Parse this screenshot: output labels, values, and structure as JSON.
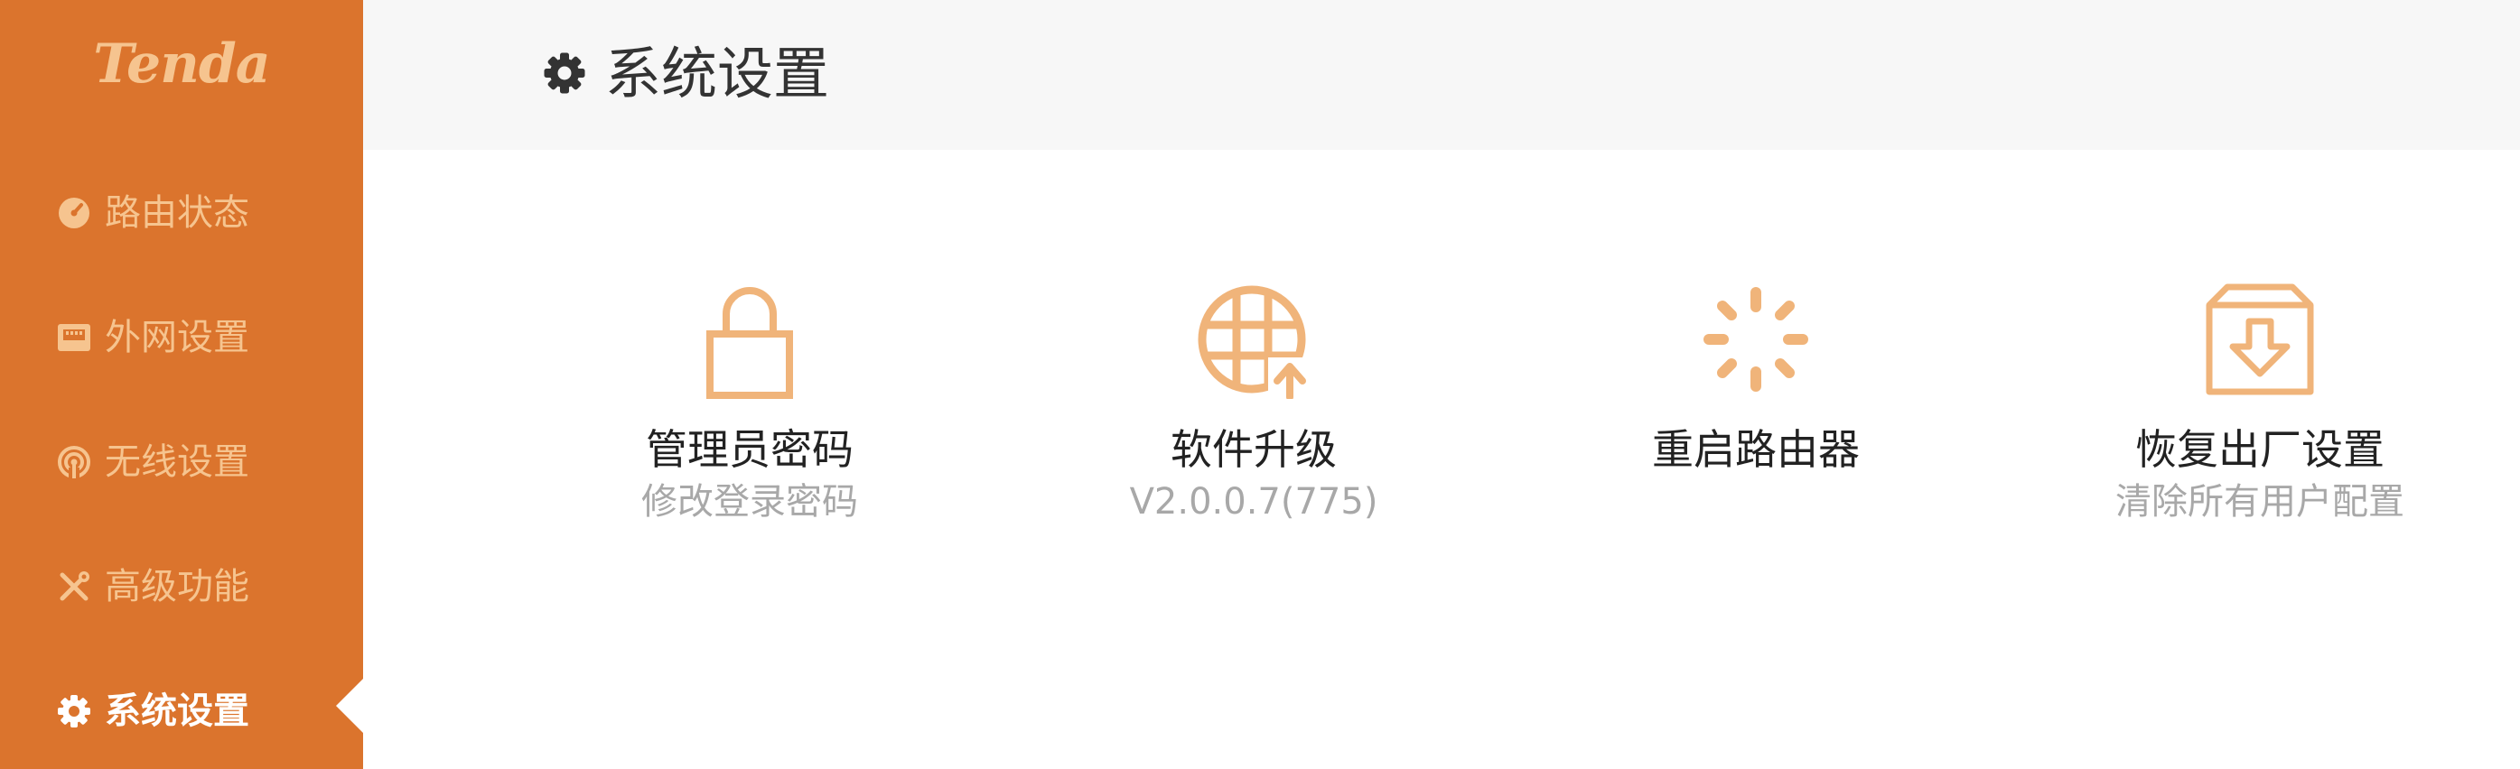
{
  "brand": {
    "logo_text": "Tenda",
    "accent_color": "#DB742D",
    "icon_color": "#F0B47A"
  },
  "sidebar": {
    "items": [
      {
        "label": "路由状态",
        "icon": "dashboard-icon",
        "active": false
      },
      {
        "label": "外网设置",
        "icon": "ethernet-port-icon",
        "active": false
      },
      {
        "label": "无线设置",
        "icon": "wireless-icon",
        "active": false
      },
      {
        "label": "高级功能",
        "icon": "tools-icon",
        "active": false
      },
      {
        "label": "系统设置",
        "icon": "gear-icon",
        "active": true
      }
    ]
  },
  "header": {
    "title": "系统设置",
    "icon": "gear-icon"
  },
  "tiles": [
    {
      "title": "管理员密码",
      "subtitle": "修改登录密码",
      "icon": "lock-icon"
    },
    {
      "title": "软件升级",
      "subtitle": "V2.0.0.7(775)",
      "icon": "globe-upgrade-icon"
    },
    {
      "title": "重启路由器",
      "subtitle": "",
      "icon": "spinner-icon"
    },
    {
      "title": "恢复出厂设置",
      "subtitle": "清除所有用户配置",
      "icon": "box-download-icon"
    }
  ]
}
